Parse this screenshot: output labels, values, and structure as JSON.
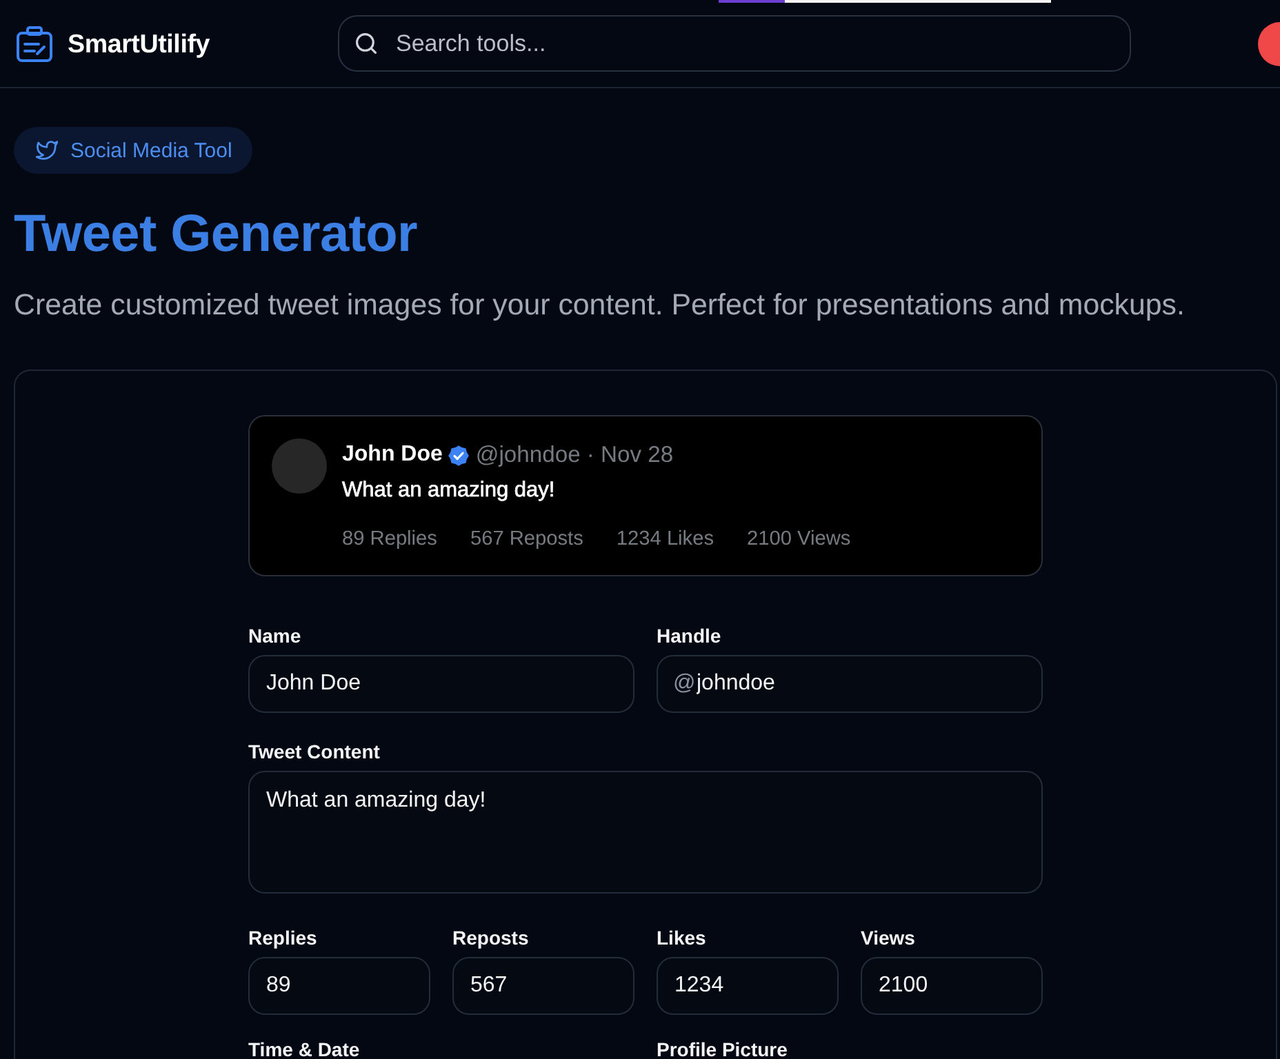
{
  "header": {
    "logo": "SmartUtilify",
    "search": {
      "placeholder": "Search tools..."
    }
  },
  "badge": {
    "label": "Social Media Tool"
  },
  "page": {
    "title": "Tweet Generator",
    "subtitle": "Create customized tweet images for your content. Perfect for presentations and mockups."
  },
  "preview": {
    "name": "John Doe",
    "verified": true,
    "meta": "@johndoe · Nov 28",
    "text": "What an amazing day!",
    "stats": [
      "89 Replies",
      "567 Reposts",
      "1234 Likes",
      "2100 Views"
    ]
  },
  "form": {
    "fields": [
      {
        "kind": "text",
        "label": "Name",
        "value": "John Doe"
      },
      {
        "kind": "prefixed",
        "label": "Handle",
        "prefix": "@",
        "value": "johndoe"
      }
    ],
    "content": {
      "label": "Tweet Content",
      "value": "What an amazing day!"
    },
    "counts": [
      {
        "label": "Replies",
        "value": "89"
      },
      {
        "label": "Reposts",
        "value": "567"
      },
      {
        "label": "Likes",
        "value": "1234"
      },
      {
        "label": "Views",
        "value": "2100"
      }
    ],
    "more_labels": [
      "Time & Date",
      "Profile Picture"
    ]
  }
}
